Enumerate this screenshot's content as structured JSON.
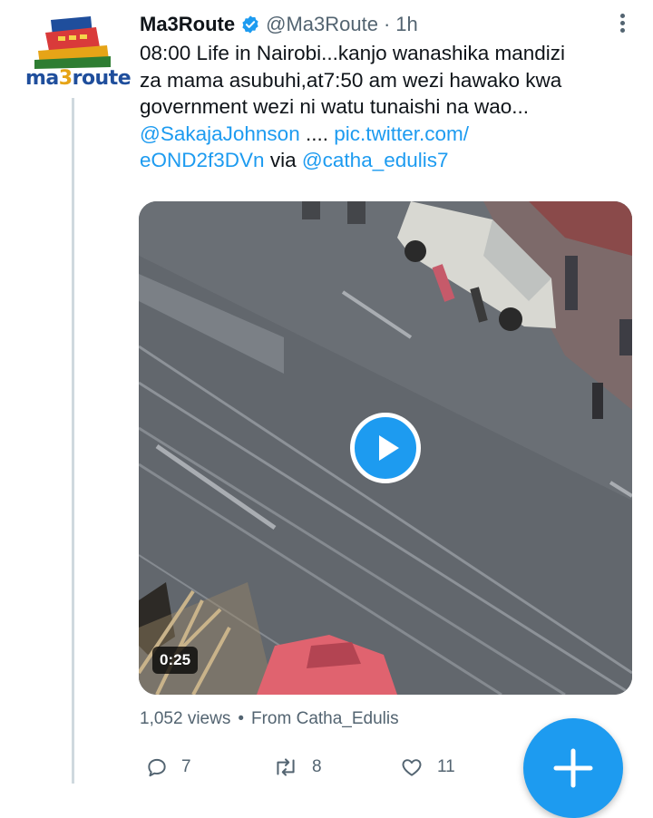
{
  "tweet": {
    "author_name": "Ma3Route",
    "author_handle": "@Ma3Route",
    "time": "1h",
    "avatar_brand": {
      "prefix": "ma",
      "three": "3",
      "suffix": "route"
    },
    "text_lines": [
      "08:00 Life in Nairobi...kanjo wanashika mandizi",
      "za mama asubuhi,at7:50 am wezi hawako kwa",
      "government wezi ni watu tunaishi na wao..."
    ],
    "mention": "@SakajaJohnson",
    "ellipsis": " .... ",
    "link_part1": "pic.twitter.com/",
    "link_part2": "eOND2f3DVn",
    "via": " via ",
    "via_handle": "@catha_edulis7",
    "video_duration": "0:25",
    "views": "1,052 views",
    "bullet": "•",
    "source": "From Catha_Edulis",
    "reply_count": "7",
    "retweet_count": "8",
    "like_count": "11"
  },
  "colors": {
    "accent": "#1d9bf0",
    "secondary_text": "#536471",
    "thread_line": "#cfd9de"
  },
  "icons": {
    "verified": "verified-badge-icon",
    "more": "more-vertical-icon",
    "reply": "reply-icon",
    "retweet": "retweet-icon",
    "like": "heart-icon",
    "compose": "plus-icon",
    "play": "play-icon"
  }
}
